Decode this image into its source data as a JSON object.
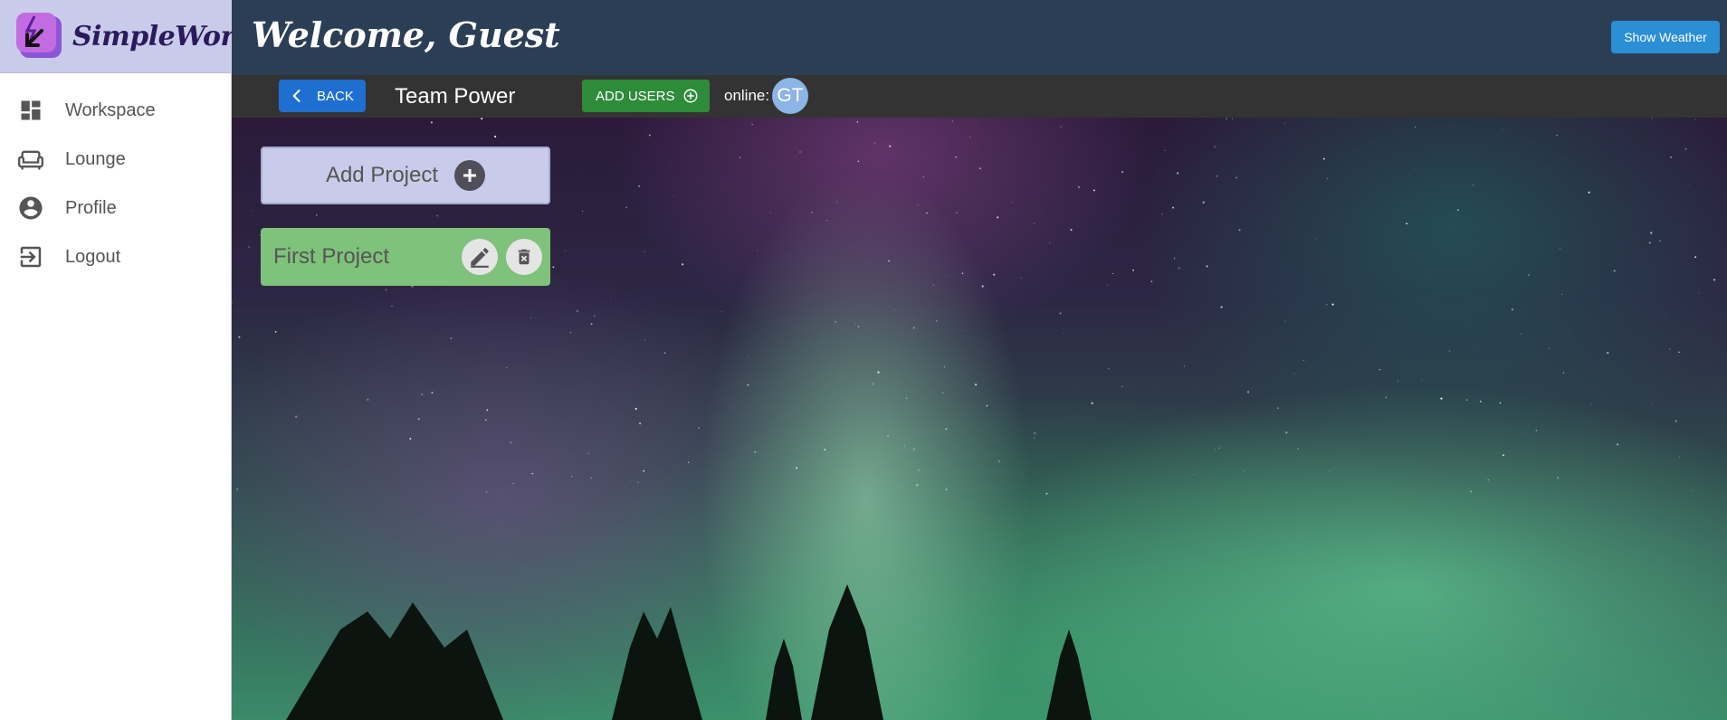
{
  "brand": {
    "name": "SimpleWork",
    "logo_icon": "lightning-arrow-logo-icon"
  },
  "sidebar": {
    "items": [
      {
        "label": "Workspace",
        "icon": "dashboard-icon"
      },
      {
        "label": "Lounge",
        "icon": "sofa-icon"
      },
      {
        "label": "Profile",
        "icon": "account-circle-icon"
      },
      {
        "label": "Logout",
        "icon": "logout-icon"
      }
    ]
  },
  "header": {
    "welcome": "Welcome, Guest",
    "weather_button": "Show Weather"
  },
  "subbar": {
    "back_label": "BACK",
    "team_name": "Team Power",
    "add_users_label": "ADD USERS",
    "online_label": "online:",
    "online_users": [
      "GT"
    ]
  },
  "main": {
    "add_project_label": "Add Project",
    "projects": [
      {
        "name": "First Project"
      }
    ]
  },
  "colors": {
    "brand_bg": "#c9cbea",
    "topbar": "#2c3e55",
    "subbar": "#333333",
    "back_button": "#1f6fd1",
    "add_users_button": "#2e8b3a",
    "weather_button": "#2b8fd6",
    "project_card": "#7fc27b"
  }
}
